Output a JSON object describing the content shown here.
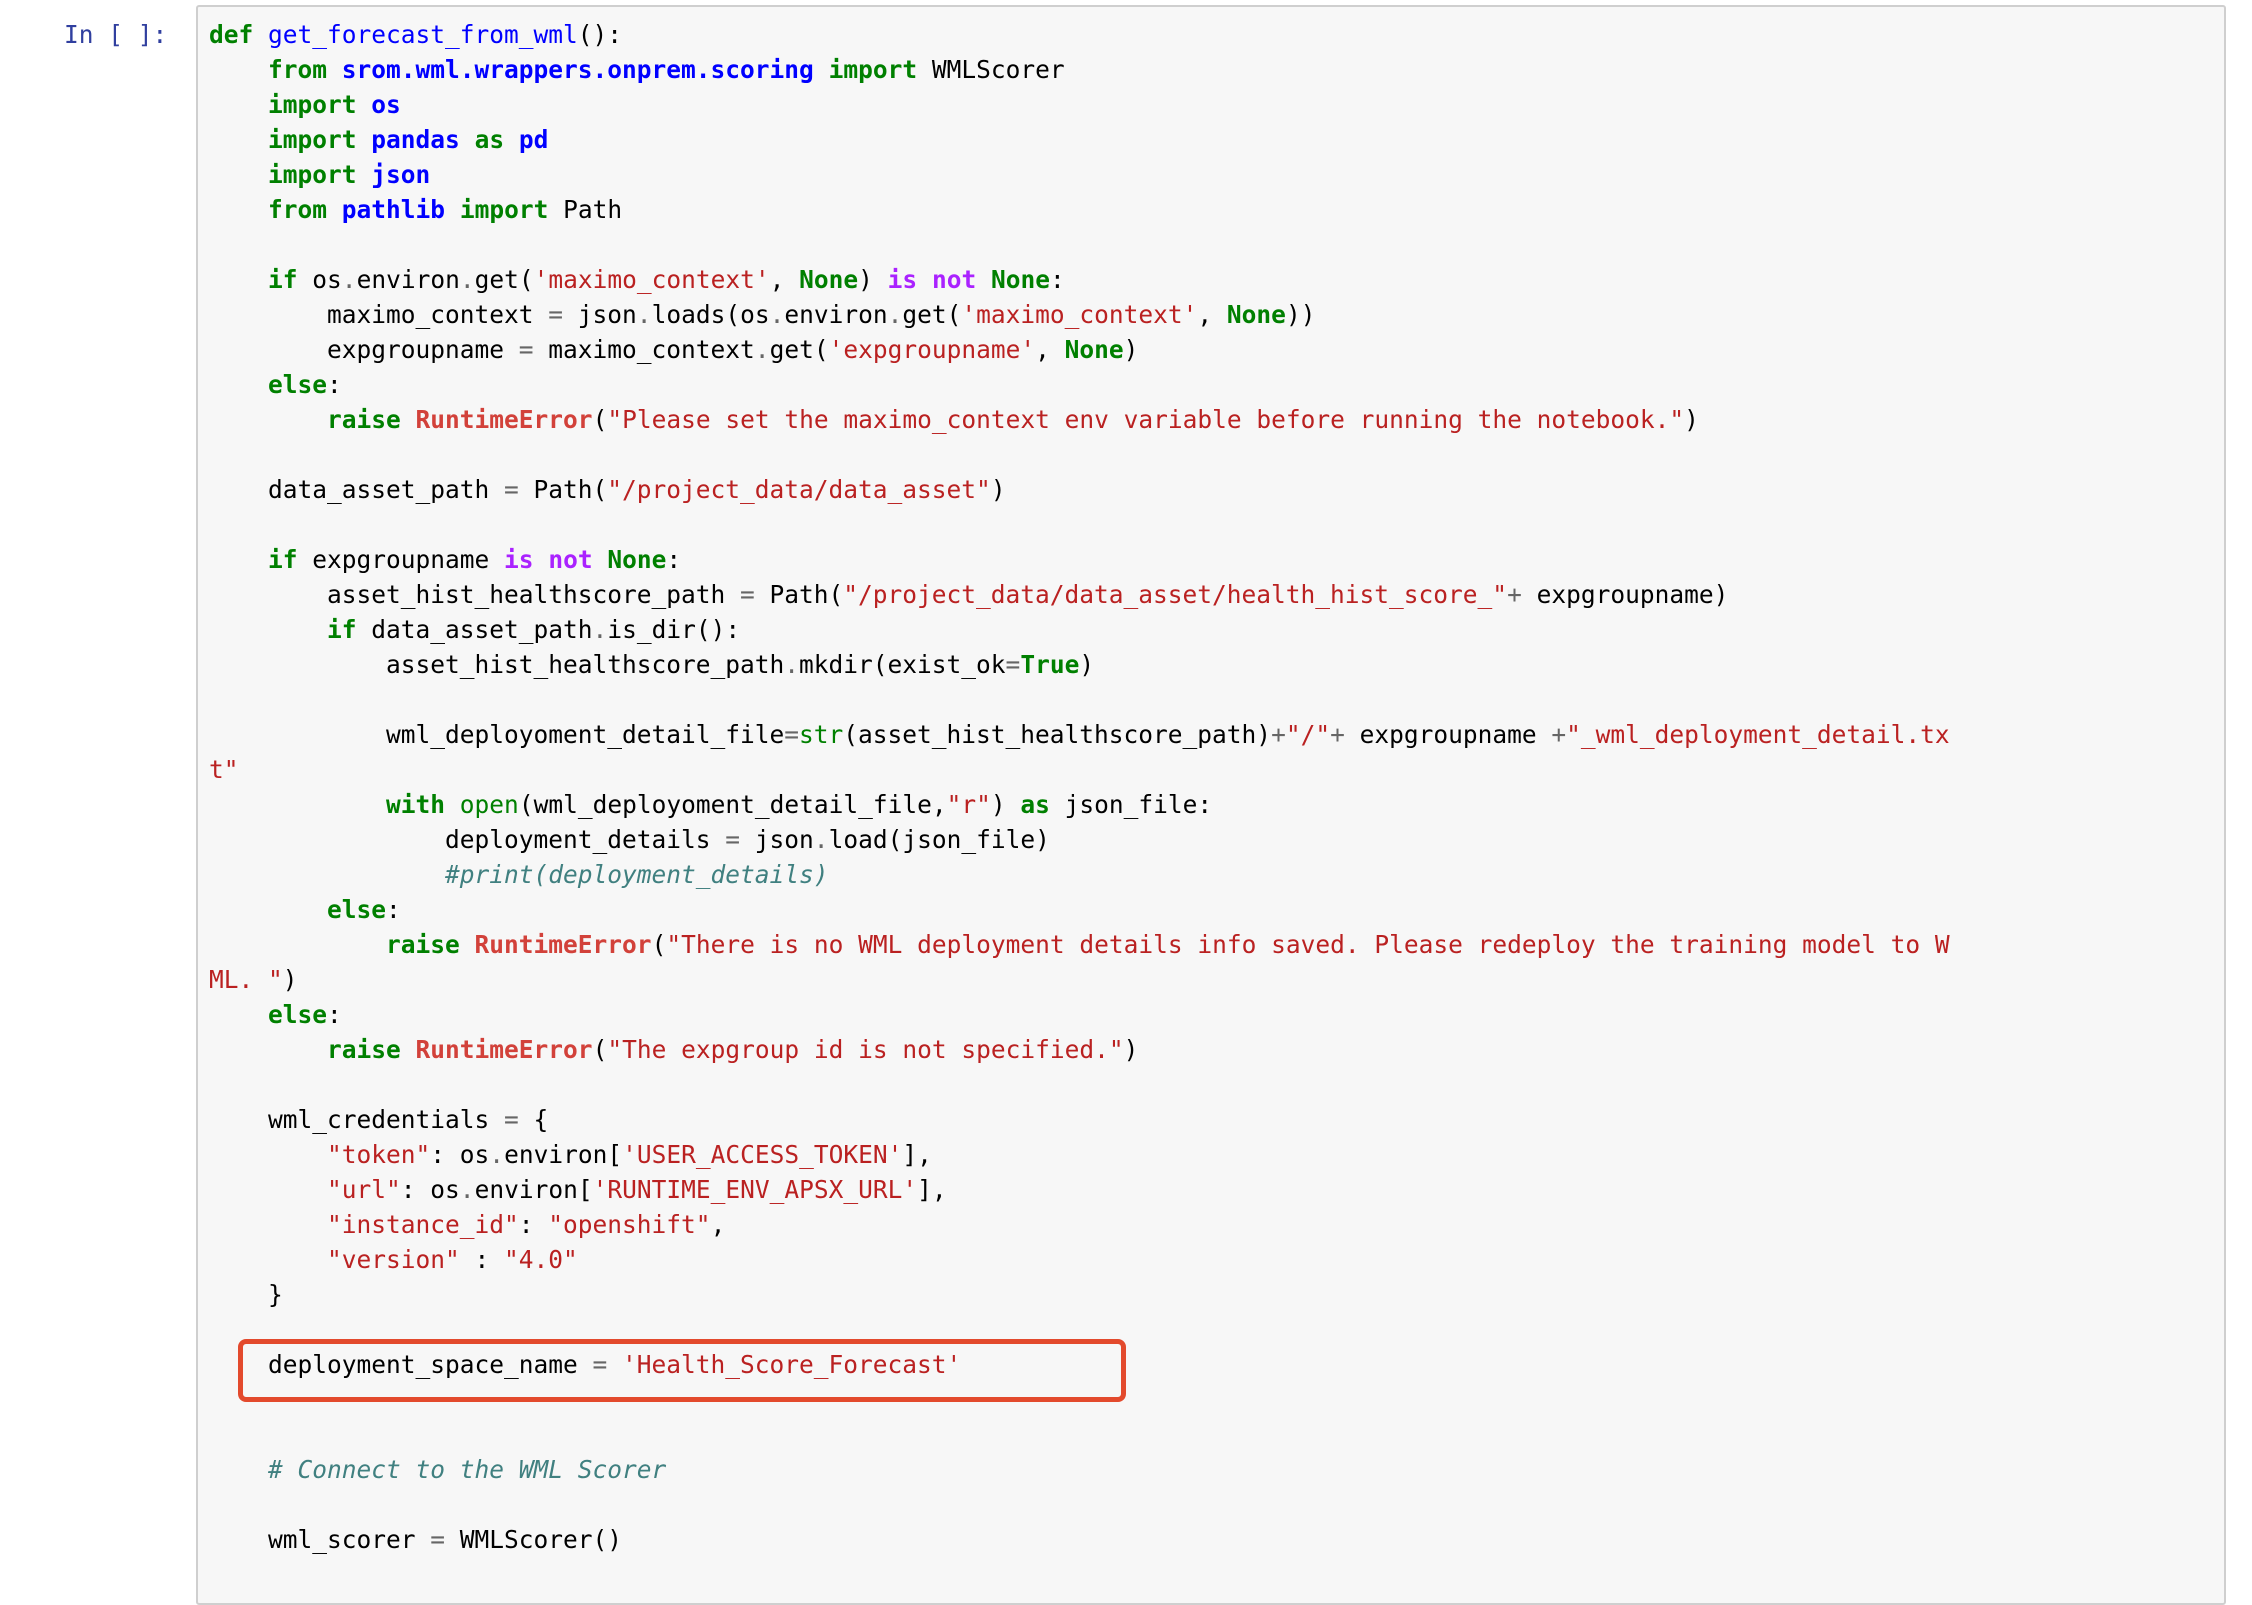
{
  "cell": {
    "prompt": "In [ ]:",
    "highlight_color": "#e34a2d",
    "lines": [
      [
        [
          "kw",
          "def"
        ],
        [
          "t",
          " "
        ],
        [
          "fn",
          "get_forecast_from_wml"
        ],
        [
          "t",
          "():"
        ]
      ],
      [
        [
          "t",
          "    "
        ],
        [
          "kw",
          "from"
        ],
        [
          "t",
          " "
        ],
        [
          "ns",
          "srom.wml.wrappers.onprem.scoring"
        ],
        [
          "t",
          " "
        ],
        [
          "kw",
          "import"
        ],
        [
          "t",
          " WMLScorer"
        ]
      ],
      [
        [
          "t",
          "    "
        ],
        [
          "kw",
          "import"
        ],
        [
          "t",
          " "
        ],
        [
          "ns",
          "os"
        ]
      ],
      [
        [
          "t",
          "    "
        ],
        [
          "kw",
          "import"
        ],
        [
          "t",
          " "
        ],
        [
          "ns",
          "pandas"
        ],
        [
          "t",
          " "
        ],
        [
          "kw",
          "as"
        ],
        [
          "t",
          " "
        ],
        [
          "ns",
          "pd"
        ]
      ],
      [
        [
          "t",
          "    "
        ],
        [
          "kw",
          "import"
        ],
        [
          "t",
          " "
        ],
        [
          "ns",
          "json"
        ]
      ],
      [
        [
          "t",
          "    "
        ],
        [
          "kw",
          "from"
        ],
        [
          "t",
          " "
        ],
        [
          "ns",
          "pathlib"
        ],
        [
          "t",
          " "
        ],
        [
          "kw",
          "import"
        ],
        [
          "t",
          " Path"
        ]
      ],
      [
        [
          "t",
          ""
        ]
      ],
      [
        [
          "t",
          "    "
        ],
        [
          "kw",
          "if"
        ],
        [
          "t",
          " os"
        ],
        [
          "op",
          "."
        ],
        [
          "t",
          "environ"
        ],
        [
          "op",
          "."
        ],
        [
          "t",
          "get("
        ],
        [
          "str",
          "'maximo_context'"
        ],
        [
          "t",
          ", "
        ],
        [
          "kw",
          "None"
        ],
        [
          "t",
          ") "
        ],
        [
          "kwn",
          "is"
        ],
        [
          "t",
          " "
        ],
        [
          "kwn",
          "not"
        ],
        [
          "t",
          " "
        ],
        [
          "kw",
          "None"
        ],
        [
          "t",
          ":"
        ]
      ],
      [
        [
          "t",
          "        maximo_context "
        ],
        [
          "op",
          "="
        ],
        [
          "t",
          " json"
        ],
        [
          "op",
          "."
        ],
        [
          "t",
          "loads(os"
        ],
        [
          "op",
          "."
        ],
        [
          "t",
          "environ"
        ],
        [
          "op",
          "."
        ],
        [
          "t",
          "get("
        ],
        [
          "str",
          "'maximo_context'"
        ],
        [
          "t",
          ", "
        ],
        [
          "kw",
          "None"
        ],
        [
          "t",
          "))"
        ]
      ],
      [
        [
          "t",
          "        expgroupname "
        ],
        [
          "op",
          "="
        ],
        [
          "t",
          " maximo_context"
        ],
        [
          "op",
          "."
        ],
        [
          "t",
          "get("
        ],
        [
          "str",
          "'expgroupname'"
        ],
        [
          "t",
          ", "
        ],
        [
          "kw",
          "None"
        ],
        [
          "t",
          ")"
        ]
      ],
      [
        [
          "t",
          "    "
        ],
        [
          "kw",
          "else"
        ],
        [
          "t",
          ":"
        ]
      ],
      [
        [
          "t",
          "        "
        ],
        [
          "kw",
          "raise"
        ],
        [
          "t",
          " "
        ],
        [
          "exc",
          "RuntimeError"
        ],
        [
          "t",
          "("
        ],
        [
          "str",
          "\"Please set the maximo_context env variable before running the notebook.\""
        ],
        [
          "t",
          ")"
        ]
      ],
      [
        [
          "t",
          ""
        ]
      ],
      [
        [
          "t",
          "    data_asset_path "
        ],
        [
          "op",
          "="
        ],
        [
          "t",
          " Path("
        ],
        [
          "str",
          "\"/project_data/data_asset\""
        ],
        [
          "t",
          ")"
        ]
      ],
      [
        [
          "t",
          ""
        ]
      ],
      [
        [
          "t",
          "    "
        ],
        [
          "kw",
          "if"
        ],
        [
          "t",
          " expgroupname "
        ],
        [
          "kwn",
          "is"
        ],
        [
          "t",
          " "
        ],
        [
          "kwn",
          "not"
        ],
        [
          "t",
          " "
        ],
        [
          "kw",
          "None"
        ],
        [
          "t",
          ":"
        ]
      ],
      [
        [
          "t",
          "        asset_hist_healthscore_path "
        ],
        [
          "op",
          "="
        ],
        [
          "t",
          " Path("
        ],
        [
          "str",
          "\"/project_data/data_asset/health_hist_score_\""
        ],
        [
          "op",
          "+"
        ],
        [
          "t",
          " expgroupname)"
        ]
      ],
      [
        [
          "t",
          "        "
        ],
        [
          "kw",
          "if"
        ],
        [
          "t",
          " data_asset_path"
        ],
        [
          "op",
          "."
        ],
        [
          "t",
          "is_dir():"
        ]
      ],
      [
        [
          "t",
          "            asset_hist_healthscore_path"
        ],
        [
          "op",
          "."
        ],
        [
          "t",
          "mkdir(exist_ok"
        ],
        [
          "op",
          "="
        ],
        [
          "kw",
          "True"
        ],
        [
          "t",
          ")"
        ]
      ],
      [
        [
          "t",
          ""
        ]
      ],
      [
        [
          "t",
          "            wml_deployoment_detail_file"
        ],
        [
          "op",
          "="
        ],
        [
          "bi",
          "str"
        ],
        [
          "t",
          "(asset_hist_healthscore_path)"
        ],
        [
          "op",
          "+"
        ],
        [
          "str",
          "\"/\""
        ],
        [
          "op",
          "+"
        ],
        [
          "t",
          " expgroupname "
        ],
        [
          "op",
          "+"
        ],
        [
          "str",
          "\"_wml_deployment_detail.tx"
        ]
      ],
      [
        [
          "str",
          "t\""
        ]
      ],
      [
        [
          "t",
          "            "
        ],
        [
          "kw",
          "with"
        ],
        [
          "t",
          " "
        ],
        [
          "bi",
          "open"
        ],
        [
          "t",
          "(wml_deployoment_detail_file,"
        ],
        [
          "str",
          "\"r\""
        ],
        [
          "t",
          ") "
        ],
        [
          "kw",
          "as"
        ],
        [
          "t",
          " json_file:"
        ]
      ],
      [
        [
          "t",
          "                deployment_details "
        ],
        [
          "op",
          "="
        ],
        [
          "t",
          " json"
        ],
        [
          "op",
          "."
        ],
        [
          "t",
          "load(json_file)"
        ]
      ],
      [
        [
          "t",
          "                "
        ],
        [
          "com",
          "#print(deployment_details)"
        ]
      ],
      [
        [
          "t",
          "        "
        ],
        [
          "kw",
          "else"
        ],
        [
          "t",
          ":"
        ]
      ],
      [
        [
          "t",
          "            "
        ],
        [
          "kw",
          "raise"
        ],
        [
          "t",
          " "
        ],
        [
          "exc",
          "RuntimeError"
        ],
        [
          "t",
          "("
        ],
        [
          "str",
          "\"There is no WML deployment details info saved. Please redeploy the training model to W"
        ]
      ],
      [
        [
          "str",
          "ML. \""
        ],
        [
          "t",
          ")"
        ]
      ],
      [
        [
          "t",
          "    "
        ],
        [
          "kw",
          "else"
        ],
        [
          "t",
          ":"
        ]
      ],
      [
        [
          "t",
          "        "
        ],
        [
          "kw",
          "raise"
        ],
        [
          "t",
          " "
        ],
        [
          "exc",
          "RuntimeError"
        ],
        [
          "t",
          "("
        ],
        [
          "str",
          "\"The expgroup id is not specified.\""
        ],
        [
          "t",
          ")"
        ]
      ],
      [
        [
          "t",
          ""
        ]
      ],
      [
        [
          "t",
          "    wml_credentials "
        ],
        [
          "op",
          "="
        ],
        [
          "t",
          " {"
        ]
      ],
      [
        [
          "t",
          "        "
        ],
        [
          "str",
          "\"token\""
        ],
        [
          "t",
          ": os"
        ],
        [
          "op",
          "."
        ],
        [
          "t",
          "environ["
        ],
        [
          "str",
          "'USER_ACCESS_TOKEN'"
        ],
        [
          "t",
          "],"
        ]
      ],
      [
        [
          "t",
          "        "
        ],
        [
          "str",
          "\"url\""
        ],
        [
          "t",
          ": os"
        ],
        [
          "op",
          "."
        ],
        [
          "t",
          "environ["
        ],
        [
          "str",
          "'RUNTIME_ENV_APSX_URL'"
        ],
        [
          "t",
          "],"
        ]
      ],
      [
        [
          "t",
          "        "
        ],
        [
          "str",
          "\"instance_id\""
        ],
        [
          "t",
          ": "
        ],
        [
          "str",
          "\"openshift\""
        ],
        [
          "t",
          ","
        ]
      ],
      [
        [
          "t",
          "        "
        ],
        [
          "str",
          "\"version\""
        ],
        [
          "t",
          " : "
        ],
        [
          "str",
          "\"4.0\""
        ]
      ],
      [
        [
          "t",
          "    }"
        ]
      ],
      [
        [
          "t",
          ""
        ]
      ],
      [
        [
          "t",
          "    deployment_space_name "
        ],
        [
          "op",
          "="
        ],
        [
          "t",
          " "
        ],
        [
          "str",
          "'Health_Score_Forecast'"
        ]
      ],
      [
        [
          "t",
          ""
        ]
      ],
      [
        [
          "t",
          ""
        ]
      ],
      [
        [
          "t",
          "    "
        ],
        [
          "com",
          "# Connect to the WML Scorer"
        ]
      ],
      [
        [
          "t",
          ""
        ]
      ],
      [
        [
          "t",
          "    wml_scorer "
        ],
        [
          "op",
          "="
        ],
        [
          "t",
          " WMLScorer()"
        ]
      ]
    ]
  }
}
